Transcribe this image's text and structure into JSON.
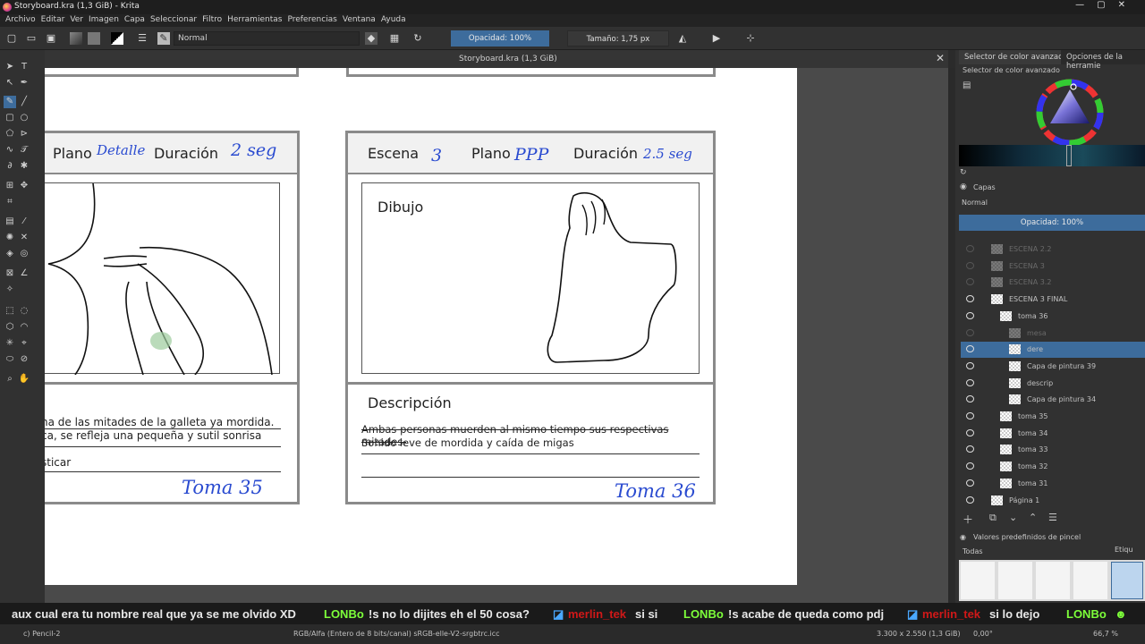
{
  "window": {
    "title": "Storyboard.kra (1,3 GiB) - Krita"
  },
  "menu": [
    "Archivo",
    "Editar",
    "Ver",
    "Imagen",
    "Capa",
    "Seleccionar",
    "Filtro",
    "Herramientas",
    "Preferencias",
    "Ventana",
    "Ayuda"
  ],
  "toolbar": {
    "blend_mode": "Normal",
    "opacity_label": "Opacidad: 100%",
    "size_label": "Tamaño: 1,75 px"
  },
  "doc_tab": {
    "title": "Storyboard.kra (1,3 GiB)"
  },
  "canvas": {
    "left_frame": {
      "plano_label": "Plano",
      "plano_value": "Detalle",
      "duracion_label": "Duración",
      "duracion_value": "2 seg",
      "desc_line1": "na de las mitades de la galleta ya mordida.",
      "desc_line2": "ca, se refleja una pequeña y sutil sonrisa",
      "desc_line3": "sticar",
      "toma": "Toma 35"
    },
    "right_frame": {
      "escena_label": "Escena",
      "escena_value": "3",
      "plano_label": "Plano",
      "plano_value": "PPP",
      "duracion_label": "Duración",
      "duracion_value": "2.5 seg",
      "dibujo_label": "Dibujo",
      "descripcion_label": "Descripción",
      "desc_line1": "Ambas personas muerden al mismo tiempo sus respectivas mitades.",
      "desc_line2": "Sonido leve de mordida y caída de migas",
      "toma": "Toma 36"
    }
  },
  "right_dock": {
    "tab1": "Selector de color avanzado",
    "tab2": "Opciones de la herramie",
    "color_panel_title": "Selector de color avanzado",
    "layers_title": "Capas",
    "layers_blend": "Normal",
    "layers_opacity": "Opacidad:  100%",
    "layers": [
      {
        "name": "ESCENA 2.2",
        "visible": false,
        "indent": 0
      },
      {
        "name": "ESCENA 3",
        "visible": false,
        "indent": 0
      },
      {
        "name": "ESCENA 3.2",
        "visible": false,
        "indent": 0
      },
      {
        "name": "ESCENA 3 FINAL",
        "visible": true,
        "indent": 0
      },
      {
        "name": "toma 36",
        "visible": true,
        "indent": 1
      },
      {
        "name": "mesa",
        "visible": false,
        "indent": 2
      },
      {
        "name": "dere",
        "visible": true,
        "indent": 2,
        "selected": true
      },
      {
        "name": "Capa de pintura 39",
        "visible": true,
        "indent": 2
      },
      {
        "name": "descrip",
        "visible": true,
        "indent": 2
      },
      {
        "name": "Capa de pintura 34",
        "visible": true,
        "indent": 2
      },
      {
        "name": "toma 35",
        "visible": true,
        "indent": 1
      },
      {
        "name": "toma 34",
        "visible": true,
        "indent": 1
      },
      {
        "name": "toma 33",
        "visible": true,
        "indent": 1
      },
      {
        "name": "toma 32",
        "visible": true,
        "indent": 1
      },
      {
        "name": "toma 31",
        "visible": true,
        "indent": 1
      },
      {
        "name": "Página 1",
        "visible": true,
        "indent": 0
      }
    ],
    "brush_presets_title": "Valores predefinidos de pincel",
    "brush_filter": "Todas",
    "brush_tag": "Etiqu"
  },
  "chat": [
    {
      "user": "",
      "text": "aux cual era tu nombre real que ya se me olvido XD",
      "color": "#e8e8e8"
    },
    {
      "user": "LONBo",
      "text": "!s no lo dijites eh el 50 cosa?",
      "color": "#7dff3a"
    },
    {
      "user": "merlin_tek",
      "text": "si si",
      "color": "#d01818"
    },
    {
      "user": "LONBo",
      "text": "!s acabe de queda como pdj",
      "color": "#7dff3a"
    },
    {
      "user": "merlin_tek",
      "text": "si lo dejo",
      "color": "#d01818"
    },
    {
      "user": "LONBo",
      "text": "",
      "color": "#7dff3a"
    }
  ],
  "status": {
    "brush": "c) Pencil-2",
    "color_space": "RGB/Alfa (Entero de 8 bits/canal)  sRGB-elle-V2-srgbtrc.icc",
    "dimensions": "3.300 x 2.550 (1,3 GiB)",
    "rotation": "0,00°",
    "zoom": "66,7 %"
  }
}
